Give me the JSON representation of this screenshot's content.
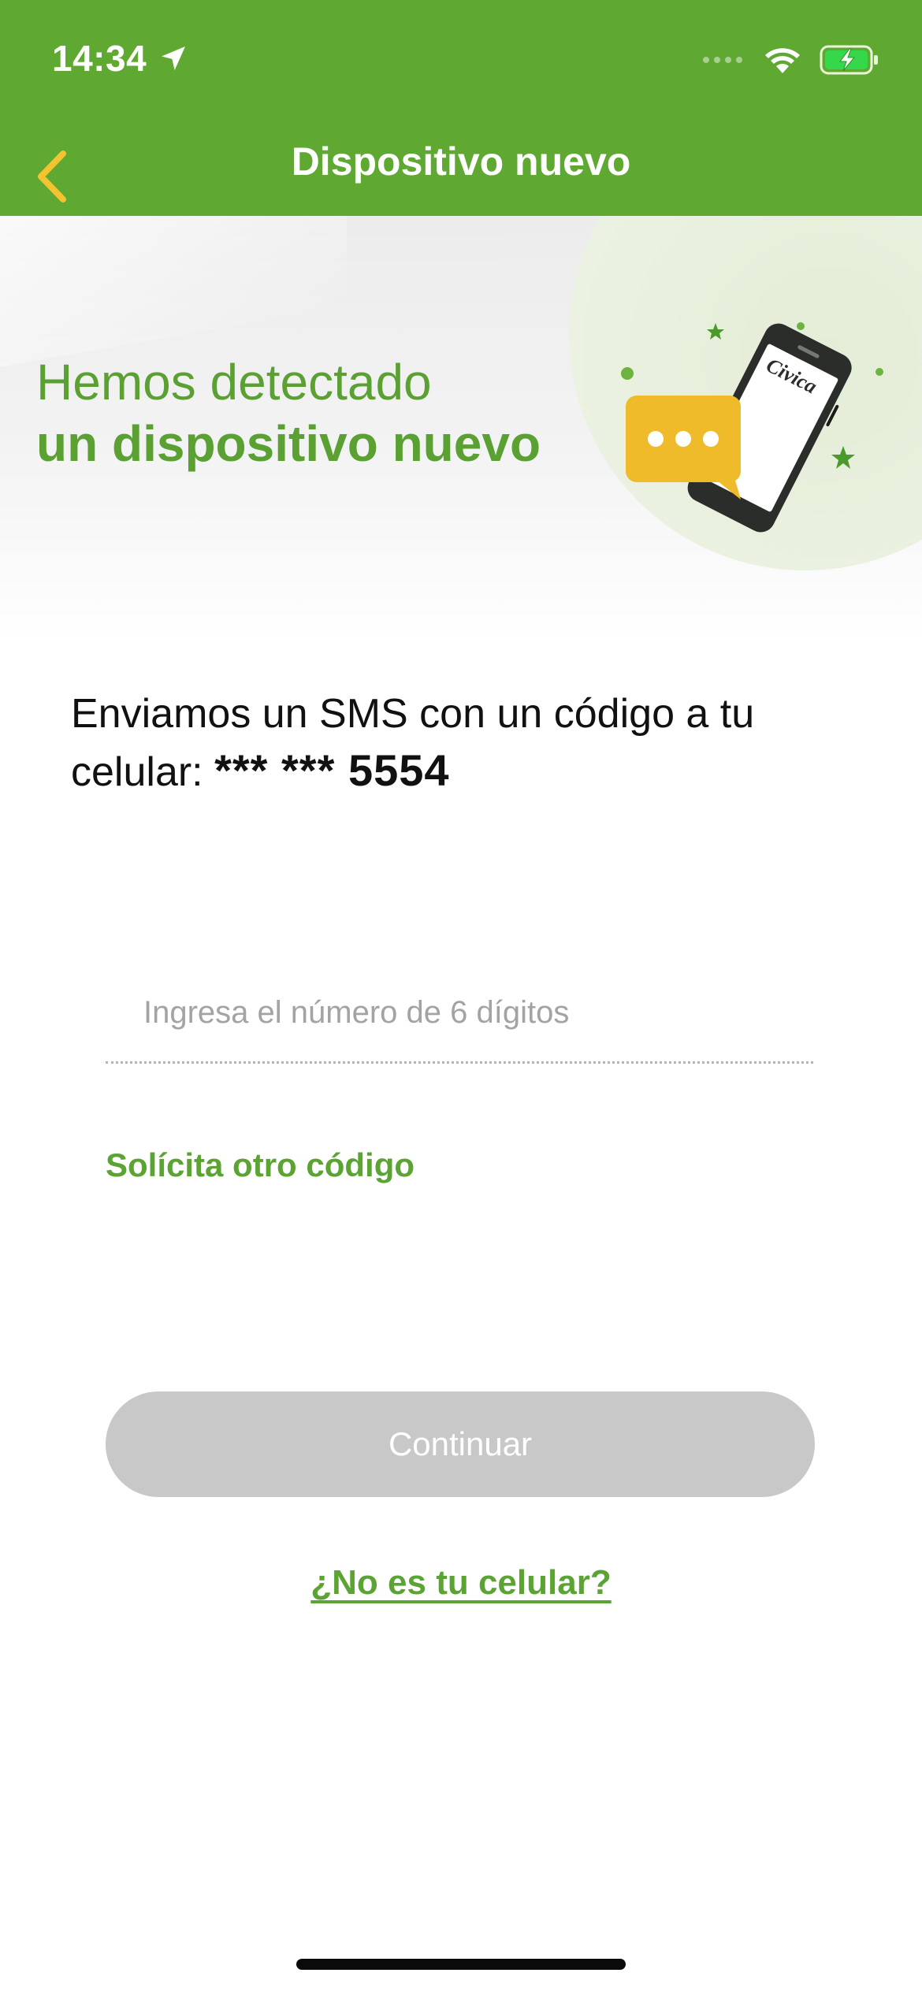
{
  "status_bar": {
    "time": "14:34",
    "icons": [
      "location-arrow-icon",
      "cellular-dots-icon",
      "wifi-icon",
      "battery-charging-icon"
    ]
  },
  "nav": {
    "title": "Dispositivo nuevo",
    "back_icon": "chevron-left-icon"
  },
  "hero": {
    "line1": "Hemos detectado",
    "line2": "un dispositivo nuevo",
    "phone_brand": "Civica"
  },
  "body": {
    "message_text": "Enviamos un SMS con un código a tu celular: ",
    "masked_phone": "*** *** 5554",
    "code_placeholder": "Ingresa el número de 6 dígitos",
    "code_value": "",
    "resend_label": "Solícita otro código",
    "continue_label": "Continuar",
    "not_mine_label": "¿No es tu celular?"
  },
  "colors": {
    "brand_green": "#5fa832",
    "accent_yellow": "#f0bb2a",
    "disabled_button": "#c8c8c8"
  }
}
